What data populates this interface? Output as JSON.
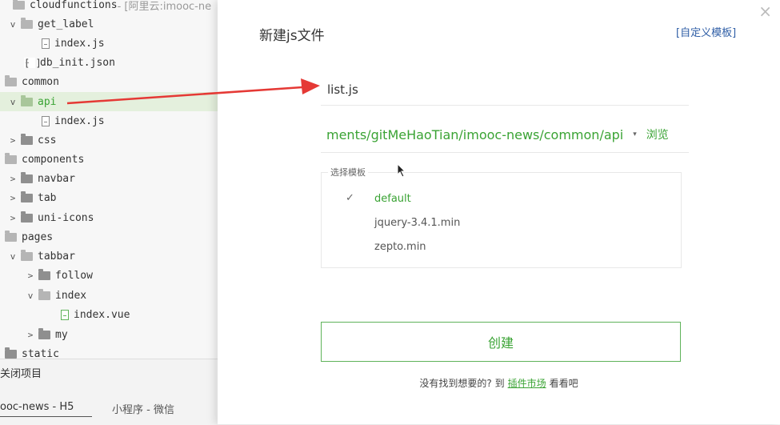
{
  "tree": {
    "items": [
      {
        "label": "cloudfunctions",
        "suffix": " - [阿里云:imooc-ne",
        "icon": "folder-open-icon",
        "chevron": ""
      },
      {
        "label": "get_label",
        "icon": "folder-open-icon",
        "chevron": "v"
      },
      {
        "label": "index.js",
        "icon": "js-file-icon",
        "chevron": ""
      },
      {
        "label": "db_init.json",
        "icon": "json-file-icon",
        "chevron": ""
      },
      {
        "label": "common",
        "icon": "folder-open-icon",
        "chevron": ""
      },
      {
        "label": "api",
        "icon": "folder-open-icon",
        "chevron": "v",
        "selected": true
      },
      {
        "label": "index.js",
        "icon": "js-file-icon",
        "chevron": ""
      },
      {
        "label": "css",
        "icon": "folder-icon",
        "chevron": ">"
      },
      {
        "label": "components",
        "icon": "folder-open-icon",
        "chevron": ""
      },
      {
        "label": "navbar",
        "icon": "folder-icon",
        "chevron": ">"
      },
      {
        "label": "tab",
        "icon": "folder-icon",
        "chevron": ">"
      },
      {
        "label": "uni-icons",
        "icon": "folder-icon",
        "chevron": ">"
      },
      {
        "label": "pages",
        "icon": "folder-open-icon",
        "chevron": ""
      },
      {
        "label": "tabbar",
        "icon": "folder-open-icon",
        "chevron": "v"
      },
      {
        "label": "follow",
        "icon": "folder-icon",
        "chevron": ">"
      },
      {
        "label": "index",
        "icon": "folder-open-icon",
        "chevron": "v"
      },
      {
        "label": "index.vue",
        "icon": "vue-file-icon",
        "chevron": ""
      },
      {
        "label": "my",
        "icon": "folder-icon",
        "chevron": ">"
      },
      {
        "label": "static",
        "icon": "folder-icon",
        "chevron": ""
      }
    ]
  },
  "bottom": {
    "close_project": "关闭项目",
    "tab_h5": "ooc-news - H5",
    "tab_wx": "小程序 - 微信"
  },
  "dialog": {
    "title": "新建js文件",
    "custom_template": "[自定义模板]",
    "close": "×",
    "filename": "list.js",
    "path": "ments/gitMeHaoTian/imooc-news/common/api",
    "path_caret": "▾",
    "browse": "浏览",
    "template_legend": "选择模板",
    "templates": [
      {
        "label": "default",
        "selected": true
      },
      {
        "label": "jquery-3.4.1.min",
        "selected": false
      },
      {
        "label": "zepto.min",
        "selected": false
      }
    ],
    "check_mark": "✓",
    "create_button": "创建",
    "footer_prefix": "没有找到想要的? 到",
    "footer_link": "插件市场",
    "footer_suffix": "看看吧"
  },
  "colors": {
    "accent_green": "#3aa334",
    "link_blue": "#2f5ea6",
    "annotation_red": "#e53935"
  }
}
